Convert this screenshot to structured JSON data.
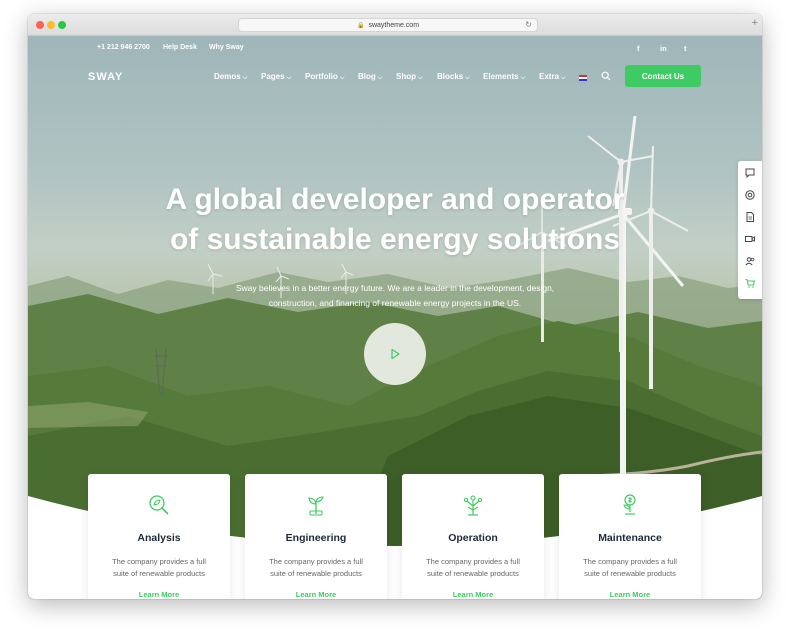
{
  "browser": {
    "url": "swaytheme.com"
  },
  "topbar": {
    "phone": "+1 212 946 2700",
    "help": "Help Desk",
    "why": "Why Sway"
  },
  "social": [
    "facebook-icon",
    "linkedin-icon",
    "twitter-icon"
  ],
  "social_glyphs": {
    "facebook": "f",
    "linkedin": "in",
    "twitter": "t"
  },
  "nav": {
    "logo": "SWAY",
    "items": [
      "Demos",
      "Pages",
      "Portfolio",
      "Blog",
      "Shop",
      "Blocks",
      "Elements",
      "Extra"
    ],
    "contact": "Contact Us"
  },
  "hero": {
    "title_line1": "A global developer and operator",
    "title_line2": "of sustainable energy solutions",
    "subtitle": "Sway believes in a better energy future. We are a leader in the development, design, construction, and financing of renewable energy projects in the US."
  },
  "side_toolbar": [
    "chat-icon",
    "support-icon",
    "document-icon",
    "video-icon",
    "users-icon",
    "cart-icon"
  ],
  "cards": [
    {
      "title": "Analysis",
      "desc": "The company provides a full suite of renewable products",
      "link": "Learn More",
      "icon": "magnifier-leaf-icon"
    },
    {
      "title": "Engineering",
      "desc": "The company provides a full suite of renewable products",
      "link": "Learn More",
      "icon": "plant-plug-icon"
    },
    {
      "title": "Operation",
      "desc": "The company provides a full suite of renewable products",
      "link": "Learn More",
      "icon": "tree-network-icon"
    },
    {
      "title": "Maintenance",
      "desc": "The company provides a full suite of renewable products",
      "link": "Learn More",
      "icon": "dollar-plant-icon"
    }
  ],
  "colors": {
    "accent": "#3fcb63",
    "heading": "#1e2a3a"
  }
}
